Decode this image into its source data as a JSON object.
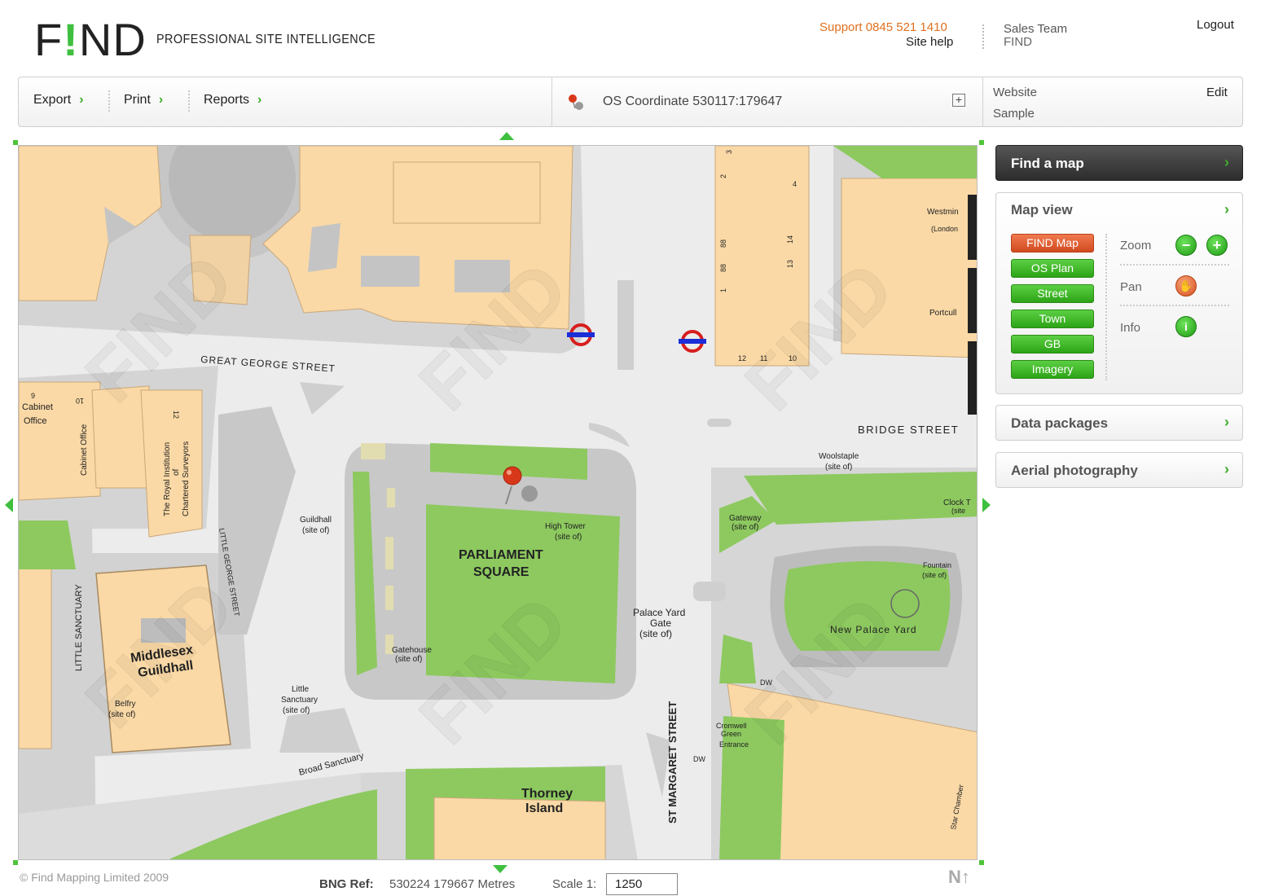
{
  "header": {
    "logo": "FIND",
    "tagline": "PROFESSIONAL SITE INTELLIGENCE",
    "support": "Support 0845 521 1410",
    "site_help": "Site help",
    "sales_team": "Sales Team",
    "sales_sub": "FIND",
    "logout": "Logout"
  },
  "toolbar": {
    "export": "Export",
    "print": "Print",
    "reports": "Reports",
    "coordinate": "OS Coordinate 530117:179647",
    "website": "Website",
    "sample": "Sample",
    "edit": "Edit"
  },
  "map": {
    "labels": {
      "parliament": "PARLIAMENT",
      "square": "SQUARE",
      "great_george_street": "GREAT GEORGE STREET",
      "bridge_street": "BRIDGE STREET",
      "st_margaret_street": "ST MARGARET STREET",
      "little_sanctuary": "LITTLE SANCTUARY",
      "little_george_street": "LITTLE GEORGE STREET",
      "broad_sanctuary": "Broad Sanctuary",
      "middlesex": "Middlesex",
      "guildhall": "Guildhall",
      "thorney": "Thorney",
      "island": "Island",
      "new_palace_yard": "New Palace Yard",
      "palace_yard": "Palace Yard",
      "gate": "Gate",
      "site_of": "(site of)",
      "guildhall_small": "Guildhall",
      "high_tower": "High Tower",
      "gatehouse": "Gatehouse",
      "little_sanctuary_small": "Little",
      "sanctuary_small": "Sanctuary",
      "belfry": "Belfry",
      "cabinet": "Cabinet",
      "office": "Office",
      "cabinet_office": "Cabinet Office",
      "royal_institution": "The Royal Institution",
      "of": "of",
      "chartered_surveyors": "Chartered Surveyors",
      "woolstaple": "Woolstaple",
      "gateway": "Gateway",
      "fountain": "Fountain",
      "clock_t": "Clock T",
      "site_short": "(site",
      "westmin": "Westmin",
      "london": "(London",
      "portcull": "Portcull",
      "cromwell": "Cromwell",
      "green": "Green",
      "entrance": "Entrance",
      "dw": "DW",
      "star_chamber": "Star Chamber",
      "n9": "9",
      "n10": "10",
      "n11": "11",
      "n12": "12",
      "n13": "13",
      "n14": "14",
      "n88": "88",
      "n1": "1",
      "n4": "4",
      "n2": "2",
      "n3": "3",
      "n10b": "10",
      "n12b": "12"
    }
  },
  "footer": {
    "copyright": "© Find Mapping Limited 2009",
    "bng_label": "BNG Ref:",
    "bng_value": "530224  179667 Metres",
    "scale_label": "Scale 1:",
    "scale_value": "1250",
    "north": "N↑"
  },
  "sidebar": {
    "find_map": "Find a map",
    "map_view": "Map view",
    "map_types": [
      "FIND Map",
      "OS Plan",
      "Street",
      "Town",
      "GB",
      "Imagery"
    ],
    "zoom": "Zoom",
    "pan": "Pan",
    "info": "Info",
    "data_packages": "Data packages",
    "aerial_photography": "Aerial photography"
  },
  "colors": {
    "accent_green": "#3fae2a",
    "support_orange": "#e0701e",
    "building": "#fad9a6",
    "grass": "#8dc95f",
    "road": "#eaeaea",
    "pavement": "#cfcfcf"
  }
}
